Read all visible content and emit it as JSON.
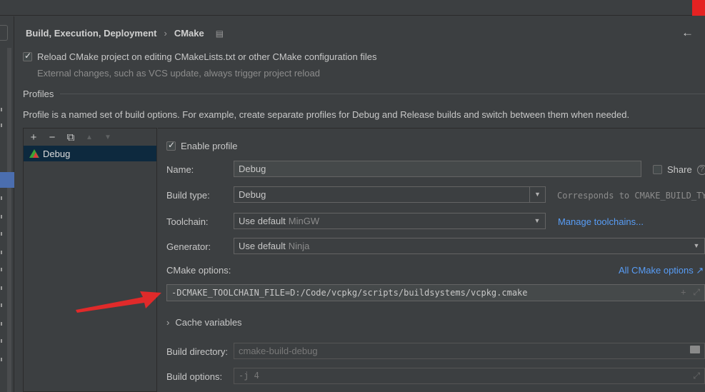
{
  "breadcrumb": {
    "parent": "Build, Execution, Deployment",
    "separator": "›",
    "current": "CMake"
  },
  "reload": {
    "checked": true,
    "label": "Reload CMake project on editing CMakeLists.txt or other CMake configuration files",
    "hint": "External changes, such as VCS update, always trigger project reload"
  },
  "profiles": {
    "title": "Profiles",
    "description": "Profile is a named set of build options. For example, create separate profiles for Debug and Release builds and switch between them when needed.",
    "toolbar": {
      "add": "+",
      "remove": "−",
      "copy": "⧉",
      "up": "▲",
      "down": "▼"
    },
    "items": [
      {
        "name": "Debug",
        "selected": true
      }
    ]
  },
  "detail": {
    "enable_profile": {
      "checked": true,
      "label": "Enable profile"
    },
    "name": {
      "label": "Name:",
      "value": "Debug"
    },
    "share": {
      "label": "Share",
      "checked": false,
      "help": "?"
    },
    "build_type": {
      "label": "Build type:",
      "value": "Debug",
      "note": "Corresponds to CMAKE_BUILD_TYPE"
    },
    "toolchain": {
      "label": "Toolchain:",
      "value": "Use default",
      "sub": "MinGW",
      "link": "Manage toolchains..."
    },
    "generator": {
      "label": "Generator:",
      "value": "Use default",
      "sub": "Ninja"
    },
    "cmake_options": {
      "label": "CMake options:",
      "link": "All CMake options ↗",
      "value": "-DCMAKE_TOOLCHAIN_FILE=D:/Code/vcpkg/scripts/buildsystems/vcpkg.cmake"
    },
    "cache_variables": {
      "label": "Cache variables"
    },
    "build_directory": {
      "label": "Build directory:",
      "value": "cmake-build-debug"
    },
    "build_options": {
      "label": "Build options:",
      "value": "-j 4"
    }
  },
  "colors": {
    "accent_link": "#589df6",
    "selection": "#0d293e",
    "annotation_arrow": "#e02a2a",
    "corner": "#e52222"
  },
  "icons": {
    "back": "arrow-left-icon",
    "expand": "expand-icon",
    "add": "plus-icon",
    "folder": "folder-icon",
    "cmake": "cmake-icon",
    "page": "page-icon"
  }
}
